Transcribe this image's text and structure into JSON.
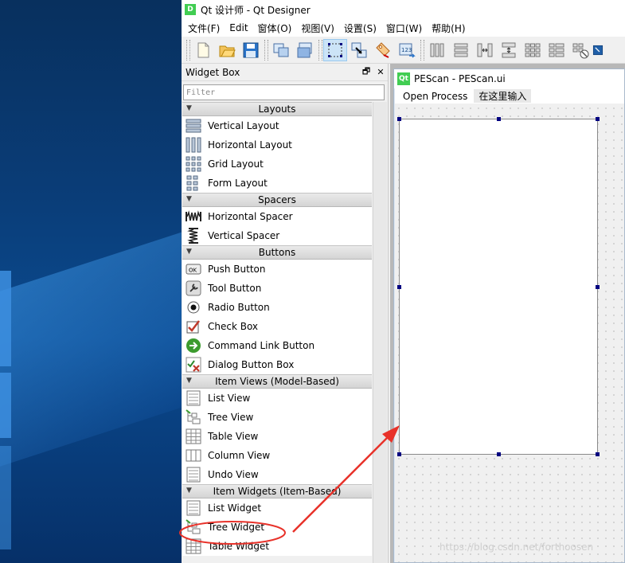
{
  "window": {
    "logo": "D",
    "title": "Qt 设计师 - Qt Designer"
  },
  "menubar": [
    "文件(F)",
    "Edit",
    "窗体(O)",
    "视图(V)",
    "设置(S)",
    "窗口(W)",
    "帮助(H)"
  ],
  "toolbar": {
    "icons": [
      "new-file-icon",
      "open-folder-icon",
      "save-disk-icon",
      "cascade-windows-icon",
      "tile-windows-icon",
      "edit-widgets-icon",
      "edit-signals-slots-icon",
      "edit-buddies-icon",
      "edit-tab-order-icon",
      "horizontal-layout-icon",
      "vertical-layout-icon",
      "horizontal-splitter-icon",
      "vertical-splitter-icon",
      "grid-layout-icon",
      "form-layout-icon",
      "break-layout-icon",
      "adjust-size-icon"
    ]
  },
  "widget_box": {
    "title": "Widget Box",
    "float_glyph": "🗗",
    "close_glyph": "✕",
    "filter_placeholder": "Filter",
    "categories": [
      {
        "label": "Layouts",
        "items": [
          {
            "label": "Vertical Layout",
            "icon": "vertical-layout-icon"
          },
          {
            "label": "Horizontal Layout",
            "icon": "horizontal-layout-icon"
          },
          {
            "label": "Grid Layout",
            "icon": "grid-layout-icon"
          },
          {
            "label": "Form Layout",
            "icon": "form-layout-icon"
          }
        ]
      },
      {
        "label": "Spacers",
        "items": [
          {
            "label": "Horizontal Spacer",
            "icon": "horizontal-spacer-icon"
          },
          {
            "label": "Vertical Spacer",
            "icon": "vertical-spacer-icon"
          }
        ]
      },
      {
        "label": "Buttons",
        "items": [
          {
            "label": "Push Button",
            "icon": "push-button-icon"
          },
          {
            "label": "Tool Button",
            "icon": "tool-button-icon"
          },
          {
            "label": "Radio Button",
            "icon": "radio-button-icon"
          },
          {
            "label": "Check Box",
            "icon": "check-box-icon"
          },
          {
            "label": "Command Link Button",
            "icon": "command-link-icon"
          },
          {
            "label": "Dialog Button Box",
            "icon": "dialog-button-box-icon"
          }
        ]
      },
      {
        "label": "Item Views (Model-Based)",
        "items": [
          {
            "label": "List View",
            "icon": "list-view-icon"
          },
          {
            "label": "Tree View",
            "icon": "tree-view-icon"
          },
          {
            "label": "Table View",
            "icon": "table-view-icon"
          },
          {
            "label": "Column View",
            "icon": "column-view-icon"
          },
          {
            "label": "Undo View",
            "icon": "undo-view-icon"
          }
        ]
      },
      {
        "label": "Item Widgets (Item-Based)",
        "items": [
          {
            "label": "List Widget",
            "icon": "list-widget-icon"
          },
          {
            "label": "Tree Widget",
            "icon": "tree-widget-icon"
          },
          {
            "label": "Table Widget",
            "icon": "table-widget-icon"
          }
        ]
      }
    ]
  },
  "form_window": {
    "badge": "Qt",
    "title": "PEScan - PEScan.ui",
    "menu_items": [
      "Open Process"
    ],
    "menu_input": "在这里输入"
  },
  "annotation": {
    "circled_item": "Tree Widget",
    "color": "#e8322a"
  },
  "watermark": "https://blog.csdn.net/forthoosen"
}
